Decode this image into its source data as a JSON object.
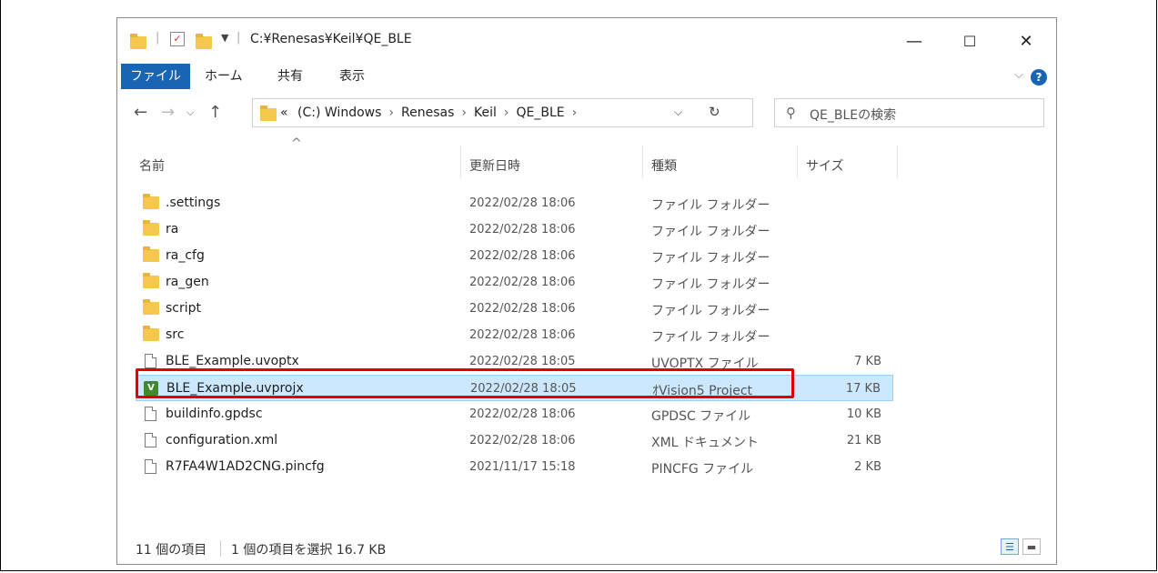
{
  "window": {
    "title": "C:¥Renesas¥Keil¥QE_BLE",
    "minimize": "—",
    "maximize": "☐",
    "close": "✕"
  },
  "ribbon": {
    "tabs": [
      "ファイル",
      "ホーム",
      "共有",
      "表示"
    ],
    "help": "?"
  },
  "address": {
    "overflow": "«",
    "crumbs": [
      "(C:) Windows",
      "Renesas",
      "Keil",
      "QE_BLE"
    ]
  },
  "search": {
    "placeholder": "QE_BLEの検索"
  },
  "columns": {
    "name": "名前",
    "modified": "更新日時",
    "type": "種類",
    "size": "サイズ"
  },
  "files": [
    {
      "name": ".settings",
      "modified": "2022/02/28 18:06",
      "type": "ファイル フォルダー",
      "size": "",
      "icon": "folder-icon"
    },
    {
      "name": "ra",
      "modified": "2022/02/28 18:06",
      "type": "ファイル フォルダー",
      "size": "",
      "icon": "folder-icon"
    },
    {
      "name": "ra_cfg",
      "modified": "2022/02/28 18:06",
      "type": "ファイル フォルダー",
      "size": "",
      "icon": "folder-icon"
    },
    {
      "name": "ra_gen",
      "modified": "2022/02/28 18:06",
      "type": "ファイル フォルダー",
      "size": "",
      "icon": "folder-icon"
    },
    {
      "name": "script",
      "modified": "2022/02/28 18:06",
      "type": "ファイル フォルダー",
      "size": "",
      "icon": "folder-icon"
    },
    {
      "name": "src",
      "modified": "2022/02/28 18:06",
      "type": "ファイル フォルダー",
      "size": "",
      "icon": "folder-icon"
    },
    {
      "name": "BLE_Example.uvoptx",
      "modified": "2022/02/28 18:05",
      "type": "UVOPTX ファイル",
      "size": "7 KB",
      "icon": "file-icon"
    },
    {
      "name": "BLE_Example.uvprojx",
      "modified": "2022/02/28 18:05",
      "type": "ｵVision5 Project",
      "size": "17 KB",
      "icon": "uvision-icon",
      "selected": true
    },
    {
      "name": "buildinfo.gpdsc",
      "modified": "2022/02/28 18:06",
      "type": "GPDSC ファイル",
      "size": "10 KB",
      "icon": "file-icon"
    },
    {
      "name": "configuration.xml",
      "modified": "2022/02/28 18:06",
      "type": "XML ドキュメント",
      "size": "21 KB",
      "icon": "file-icon"
    },
    {
      "name": "R7FA4W1AD2CNG.pincfg",
      "modified": "2021/11/17 15:18",
      "type": "PINCFG ファイル",
      "size": "2 KB",
      "icon": "file-icon"
    }
  ],
  "status": {
    "count": "11 個の項目",
    "selection": "1 個の項目を選択  16.7 KB"
  },
  "colors": {
    "accent": "#1a64b4",
    "selection": "#cce8ff",
    "highlight_border": "#e00000"
  }
}
